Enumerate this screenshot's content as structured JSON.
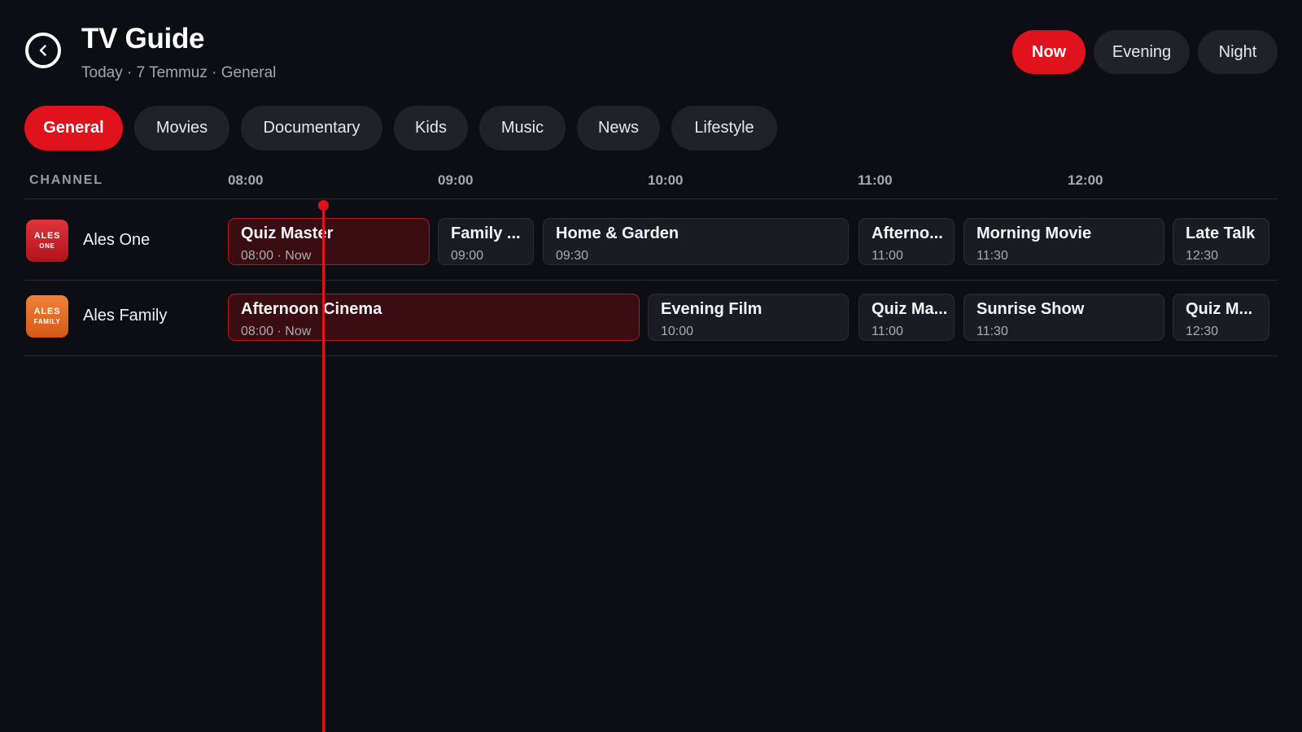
{
  "header": {
    "title": "TV Guide",
    "subtitle": "Today · 7 Temmuz · General"
  },
  "time_tabs": [
    {
      "label": "Now",
      "active": true
    },
    {
      "label": "Evening",
      "active": false
    },
    {
      "label": "Night",
      "active": false
    }
  ],
  "categories": [
    {
      "label": "General",
      "active": true
    },
    {
      "label": "Movies",
      "active": false
    },
    {
      "label": "Documentary",
      "active": false
    },
    {
      "label": "Kids",
      "active": false
    },
    {
      "label": "Music",
      "active": false
    },
    {
      "label": "News",
      "active": false
    },
    {
      "label": "Lifestyle",
      "active": false
    }
  ],
  "timeline": {
    "channel_label": "CHANNEL",
    "ticks": [
      "08:00",
      "09:00",
      "10:00",
      "11:00",
      "12:00"
    ]
  },
  "channels": [
    {
      "name": "Ales One",
      "logo_line1": "ALES",
      "logo_line2": "ONE",
      "programs": [
        {
          "title": "Quiz Master",
          "sub": "08:00 · Now",
          "live": true
        },
        {
          "title": "Family ...",
          "sub": "09:00",
          "live": false
        },
        {
          "title": "Home & Garden",
          "sub": "09:30",
          "live": false
        },
        {
          "title": "Afterno...",
          "sub": "11:00",
          "live": false
        },
        {
          "title": "Morning Movie",
          "sub": "11:30",
          "live": false
        },
        {
          "title": "Late Talk",
          "sub": "12:30",
          "live": false
        }
      ]
    },
    {
      "name": "Ales Family",
      "logo_line1": "ALES",
      "logo_line2": "FAMILY",
      "programs": [
        {
          "title": "Afternoon Cinema",
          "sub": "08:00 · Now",
          "live": true
        },
        {
          "title": "Evening Film",
          "sub": "10:00",
          "live": false
        },
        {
          "title": "Quiz Ma...",
          "sub": "11:00",
          "live": false
        },
        {
          "title": "Sunrise Show",
          "sub": "11:30",
          "live": false
        },
        {
          "title": "Quiz M...",
          "sub": "12:30",
          "live": false
        }
      ]
    }
  ],
  "colors": {
    "accent": "#e0121c",
    "background": "#0d0e14",
    "pill": "#20222a"
  }
}
